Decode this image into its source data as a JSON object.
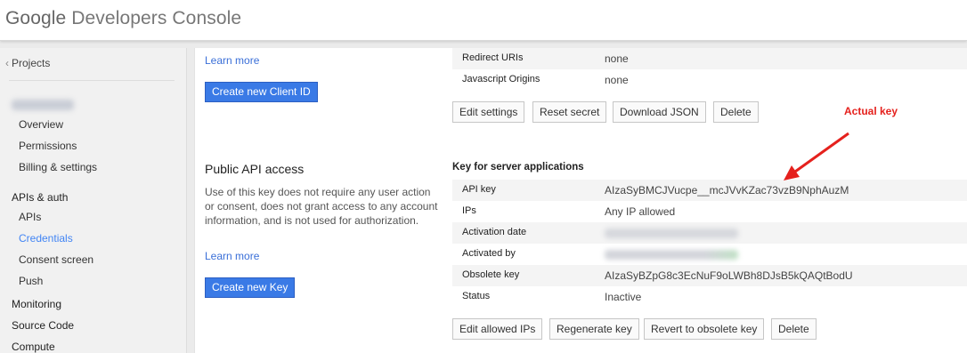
{
  "header": {
    "brand_google": "Google",
    "brand_product": "Developers Console"
  },
  "sidebar": {
    "projects_label": "Projects",
    "items": [
      {
        "label": "Overview",
        "level": "sub"
      },
      {
        "label": "Permissions",
        "level": "sub"
      },
      {
        "label": "Billing & settings",
        "level": "sub"
      },
      {
        "label": "APIs & auth",
        "level": "top"
      },
      {
        "label": "APIs",
        "level": "sub"
      },
      {
        "label": "Credentials",
        "level": "sub",
        "active": true
      },
      {
        "label": "Consent screen",
        "level": "sub"
      },
      {
        "label": "Push",
        "level": "sub"
      },
      {
        "label": "Monitoring",
        "level": "top"
      },
      {
        "label": "Source Code",
        "level": "top"
      },
      {
        "label": "Compute",
        "level": "top"
      }
    ]
  },
  "oauth": {
    "learn_more": "Learn more",
    "create_button": "Create new Client ID",
    "rows": [
      {
        "key": "Redirect URIs",
        "value": "none"
      },
      {
        "key": "Javascript Origins",
        "value": "none"
      }
    ],
    "buttons": {
      "edit_settings": "Edit settings",
      "reset_secret": "Reset secret",
      "download_json": "Download JSON",
      "delete": "Delete"
    }
  },
  "public_api": {
    "title": "Public API access",
    "description": "Use of this key does not require any user action or consent, does not grant access to any account information, and is not used for authorization.",
    "learn_more": "Learn more",
    "create_button": "Create new Key",
    "key_header": "Key for server applications",
    "rows": {
      "api_key": {
        "key": "API key",
        "value": "AIzaSyBMCJVucpe__mcJVvKZac73vzB9NphAuzM"
      },
      "ips": {
        "key": "IPs",
        "value": "Any IP allowed"
      },
      "activation_date": {
        "key": "Activation date"
      },
      "activated_by": {
        "key": "Activated by"
      },
      "obsolete_key": {
        "key": "Obsolete key",
        "value": "AIzaSyBZpG8c3EcNuF9oLWBh8DJsB5kQAQtBodU"
      },
      "status": {
        "key": "Status",
        "value": "Inactive"
      }
    },
    "buttons": {
      "edit_allowed_ips": "Edit allowed IPs",
      "regenerate_key": "Regenerate key",
      "revert_obsolete": "Revert to obsolete key",
      "delete": "Delete"
    }
  },
  "annotation": {
    "label": "Actual key",
    "color": "#e5211d"
  },
  "colors": {
    "accent": "#3a7ae6",
    "link": "#3a6fd8",
    "active_nav": "#4285f4"
  }
}
